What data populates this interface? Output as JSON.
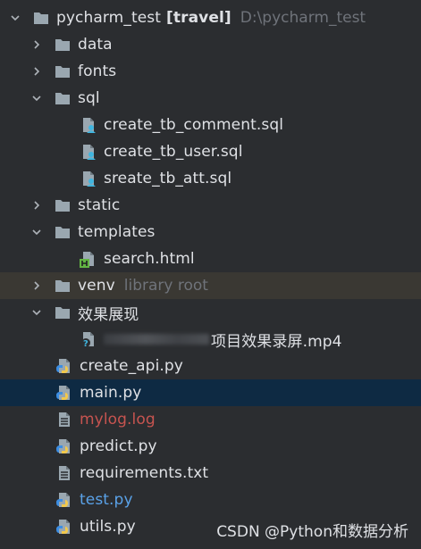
{
  "project": {
    "name": "pycharm_test",
    "module": "[travel]",
    "path": "D:\\pycharm_test"
  },
  "items": {
    "data": "data",
    "fonts": "fonts",
    "sql": "sql",
    "sql_file_1": "create_tb_comment.sql",
    "sql_file_2": "create_tb_user.sql",
    "sql_file_3": "sreate_tb_att.sql",
    "static": "static",
    "templates": "templates",
    "search_html": "search.html",
    "venv": "venv",
    "venv_hint": "library root",
    "effect_folder": "效果展现",
    "effect_video": "项目效果录屏.mp4",
    "create_api": "create_api.py",
    "main": "main.py",
    "mylog": "mylog.log",
    "predict": "predict.py",
    "requirements": "requirements.txt",
    "test": "test.py",
    "utils": "utils.py"
  },
  "watermark": "CSDN @Python和数据分析",
  "colors": {
    "background": "#2b2d30",
    "selected_row": "#0e2a43",
    "excluded_row": "#3a3833",
    "text": "#dfe1e5",
    "hint": "#6f737a",
    "error_file": "#c75450",
    "modified_file": "#5aa2e8",
    "folder": "#9aa7b0"
  },
  "icons": {
    "folder": "folder-icon",
    "sql": "sql-file-icon",
    "html": "html-file-icon",
    "python": "python-file-icon",
    "text": "text-file-icon",
    "unknown": "unknown-file-icon",
    "expanded": "chevron-down-icon",
    "collapsed": "chevron-right-icon"
  }
}
